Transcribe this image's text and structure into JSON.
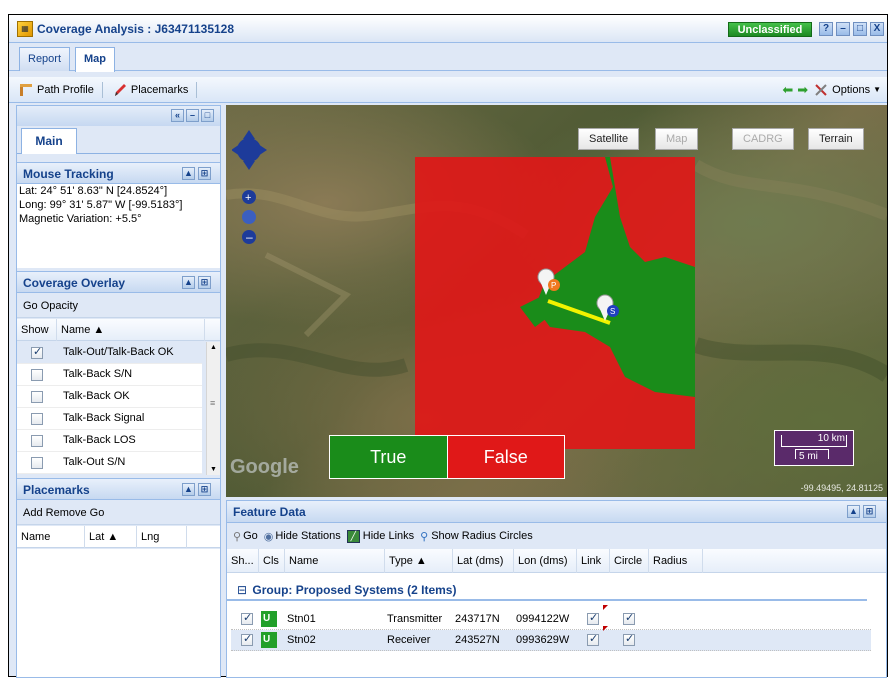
{
  "window": {
    "title": "Coverage Analysis : J63471135128",
    "classification": "Unclassified",
    "buttons": [
      "?",
      "–",
      "□",
      "X"
    ]
  },
  "tabs": [
    {
      "label": "Report",
      "active": false
    },
    {
      "label": "Map",
      "active": true
    }
  ],
  "toolbar": {
    "path_profile": "Path Profile",
    "placemarks": "Placemarks",
    "options": "Options"
  },
  "left_panel": {
    "main_tab": "Main",
    "mouse_tracking": {
      "title": "Mouse Tracking",
      "lat": "Lat: 24° 51' 8.63\" N [24.8524°]",
      "long": "Long: 99° 31' 5.87\" W [-99.5183°]",
      "magvar": "Magnetic Variation: +5.5°"
    },
    "coverage_overlay": {
      "title": "Coverage Overlay",
      "links": "Go  Opacity",
      "col_show": "Show",
      "col_name": "Name ▲",
      "rows": [
        {
          "name": "Talk-Out/Talk-Back OK",
          "checked": true,
          "selected": true
        },
        {
          "name": "Talk-Back S/N",
          "checked": false,
          "selected": false
        },
        {
          "name": "Talk-Back OK",
          "checked": false,
          "selected": false
        },
        {
          "name": "Talk-Back Signal",
          "checked": false,
          "selected": false
        },
        {
          "name": "Talk-Back LOS",
          "checked": false,
          "selected": false
        },
        {
          "name": "Talk-Out S/N",
          "checked": false,
          "selected": false
        }
      ]
    },
    "placemarks": {
      "title": "Placemarks",
      "links": "Add  Remove  Go",
      "col_name": "Name",
      "col_lat": "Lat ▲",
      "col_lng": "Lng"
    }
  },
  "map": {
    "buttons": [
      "Satellite",
      "Map",
      "CADRG",
      "Terrain"
    ],
    "legend_true": "True",
    "legend_false": "False",
    "scale_km": "10 km",
    "scale_mi": "5 mi",
    "coord_readout": "-99.49495, 24.81125",
    "google": "Google",
    "marker_p": "P",
    "marker_s": "S",
    "colors": {
      "coverage_true": "#1a8c1a",
      "coverage_false": "#e01818",
      "link_line": "#f2f200"
    }
  },
  "feature_data": {
    "title": "Feature Data",
    "tools": {
      "go": "Go",
      "hide_stations": "Hide Stations",
      "hide_links": "Hide Links",
      "show_radius": "Show Radius Circles"
    },
    "columns": [
      "Sh...",
      "Cls",
      "Name",
      "Type ▲",
      "Lat (dms)",
      "Lon (dms)",
      "Link",
      "Circle",
      "Radius"
    ],
    "group": "Group: Proposed Systems (2 Items)",
    "rows": [
      {
        "cls": "U [(",
        "name": "Stn01",
        "type": "Transmitter",
        "lat": "243717N",
        "lon": "0994122W",
        "show": true,
        "link": true,
        "circle": true
      },
      {
        "cls": "U [(",
        "name": "Stn02",
        "type": "Receiver",
        "lat": "243527N",
        "lon": "0993629W",
        "show": true,
        "link": true,
        "circle": true
      }
    ]
  }
}
